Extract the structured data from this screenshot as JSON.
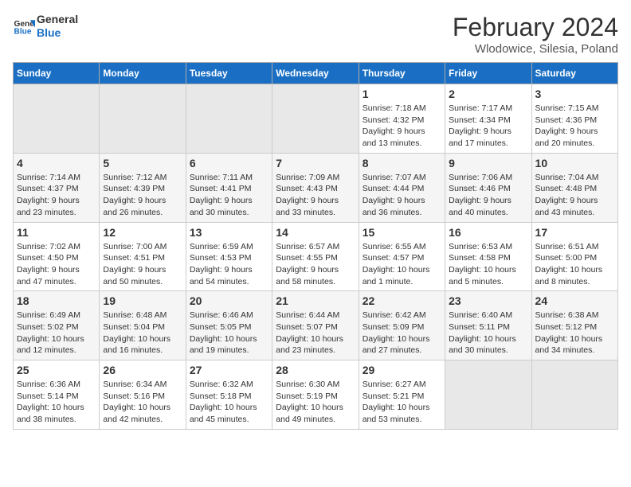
{
  "logo": {
    "text_general": "General",
    "text_blue": "Blue"
  },
  "title": "February 2024",
  "subtitle": "Wlodowice, Silesia, Poland",
  "days_of_week": [
    "Sunday",
    "Monday",
    "Tuesday",
    "Wednesday",
    "Thursday",
    "Friday",
    "Saturday"
  ],
  "weeks": [
    [
      {
        "day": "",
        "info": ""
      },
      {
        "day": "",
        "info": ""
      },
      {
        "day": "",
        "info": ""
      },
      {
        "day": "",
        "info": ""
      },
      {
        "day": "1",
        "info": "Sunrise: 7:18 AM\nSunset: 4:32 PM\nDaylight: 9 hours\nand 13 minutes."
      },
      {
        "day": "2",
        "info": "Sunrise: 7:17 AM\nSunset: 4:34 PM\nDaylight: 9 hours\nand 17 minutes."
      },
      {
        "day": "3",
        "info": "Sunrise: 7:15 AM\nSunset: 4:36 PM\nDaylight: 9 hours\nand 20 minutes."
      }
    ],
    [
      {
        "day": "4",
        "info": "Sunrise: 7:14 AM\nSunset: 4:37 PM\nDaylight: 9 hours\nand 23 minutes."
      },
      {
        "day": "5",
        "info": "Sunrise: 7:12 AM\nSunset: 4:39 PM\nDaylight: 9 hours\nand 26 minutes."
      },
      {
        "day": "6",
        "info": "Sunrise: 7:11 AM\nSunset: 4:41 PM\nDaylight: 9 hours\nand 30 minutes."
      },
      {
        "day": "7",
        "info": "Sunrise: 7:09 AM\nSunset: 4:43 PM\nDaylight: 9 hours\nand 33 minutes."
      },
      {
        "day": "8",
        "info": "Sunrise: 7:07 AM\nSunset: 4:44 PM\nDaylight: 9 hours\nand 36 minutes."
      },
      {
        "day": "9",
        "info": "Sunrise: 7:06 AM\nSunset: 4:46 PM\nDaylight: 9 hours\nand 40 minutes."
      },
      {
        "day": "10",
        "info": "Sunrise: 7:04 AM\nSunset: 4:48 PM\nDaylight: 9 hours\nand 43 minutes."
      }
    ],
    [
      {
        "day": "11",
        "info": "Sunrise: 7:02 AM\nSunset: 4:50 PM\nDaylight: 9 hours\nand 47 minutes."
      },
      {
        "day": "12",
        "info": "Sunrise: 7:00 AM\nSunset: 4:51 PM\nDaylight: 9 hours\nand 50 minutes."
      },
      {
        "day": "13",
        "info": "Sunrise: 6:59 AM\nSunset: 4:53 PM\nDaylight: 9 hours\nand 54 minutes."
      },
      {
        "day": "14",
        "info": "Sunrise: 6:57 AM\nSunset: 4:55 PM\nDaylight: 9 hours\nand 58 minutes."
      },
      {
        "day": "15",
        "info": "Sunrise: 6:55 AM\nSunset: 4:57 PM\nDaylight: 10 hours\nand 1 minute."
      },
      {
        "day": "16",
        "info": "Sunrise: 6:53 AM\nSunset: 4:58 PM\nDaylight: 10 hours\nand 5 minutes."
      },
      {
        "day": "17",
        "info": "Sunrise: 6:51 AM\nSunset: 5:00 PM\nDaylight: 10 hours\nand 8 minutes."
      }
    ],
    [
      {
        "day": "18",
        "info": "Sunrise: 6:49 AM\nSunset: 5:02 PM\nDaylight: 10 hours\nand 12 minutes."
      },
      {
        "day": "19",
        "info": "Sunrise: 6:48 AM\nSunset: 5:04 PM\nDaylight: 10 hours\nand 16 minutes."
      },
      {
        "day": "20",
        "info": "Sunrise: 6:46 AM\nSunset: 5:05 PM\nDaylight: 10 hours\nand 19 minutes."
      },
      {
        "day": "21",
        "info": "Sunrise: 6:44 AM\nSunset: 5:07 PM\nDaylight: 10 hours\nand 23 minutes."
      },
      {
        "day": "22",
        "info": "Sunrise: 6:42 AM\nSunset: 5:09 PM\nDaylight: 10 hours\nand 27 minutes."
      },
      {
        "day": "23",
        "info": "Sunrise: 6:40 AM\nSunset: 5:11 PM\nDaylight: 10 hours\nand 30 minutes."
      },
      {
        "day": "24",
        "info": "Sunrise: 6:38 AM\nSunset: 5:12 PM\nDaylight: 10 hours\nand 34 minutes."
      }
    ],
    [
      {
        "day": "25",
        "info": "Sunrise: 6:36 AM\nSunset: 5:14 PM\nDaylight: 10 hours\nand 38 minutes."
      },
      {
        "day": "26",
        "info": "Sunrise: 6:34 AM\nSunset: 5:16 PM\nDaylight: 10 hours\nand 42 minutes."
      },
      {
        "day": "27",
        "info": "Sunrise: 6:32 AM\nSunset: 5:18 PM\nDaylight: 10 hours\nand 45 minutes."
      },
      {
        "day": "28",
        "info": "Sunrise: 6:30 AM\nSunset: 5:19 PM\nDaylight: 10 hours\nand 49 minutes."
      },
      {
        "day": "29",
        "info": "Sunrise: 6:27 AM\nSunset: 5:21 PM\nDaylight: 10 hours\nand 53 minutes."
      },
      {
        "day": "",
        "info": ""
      },
      {
        "day": "",
        "info": ""
      }
    ]
  ]
}
